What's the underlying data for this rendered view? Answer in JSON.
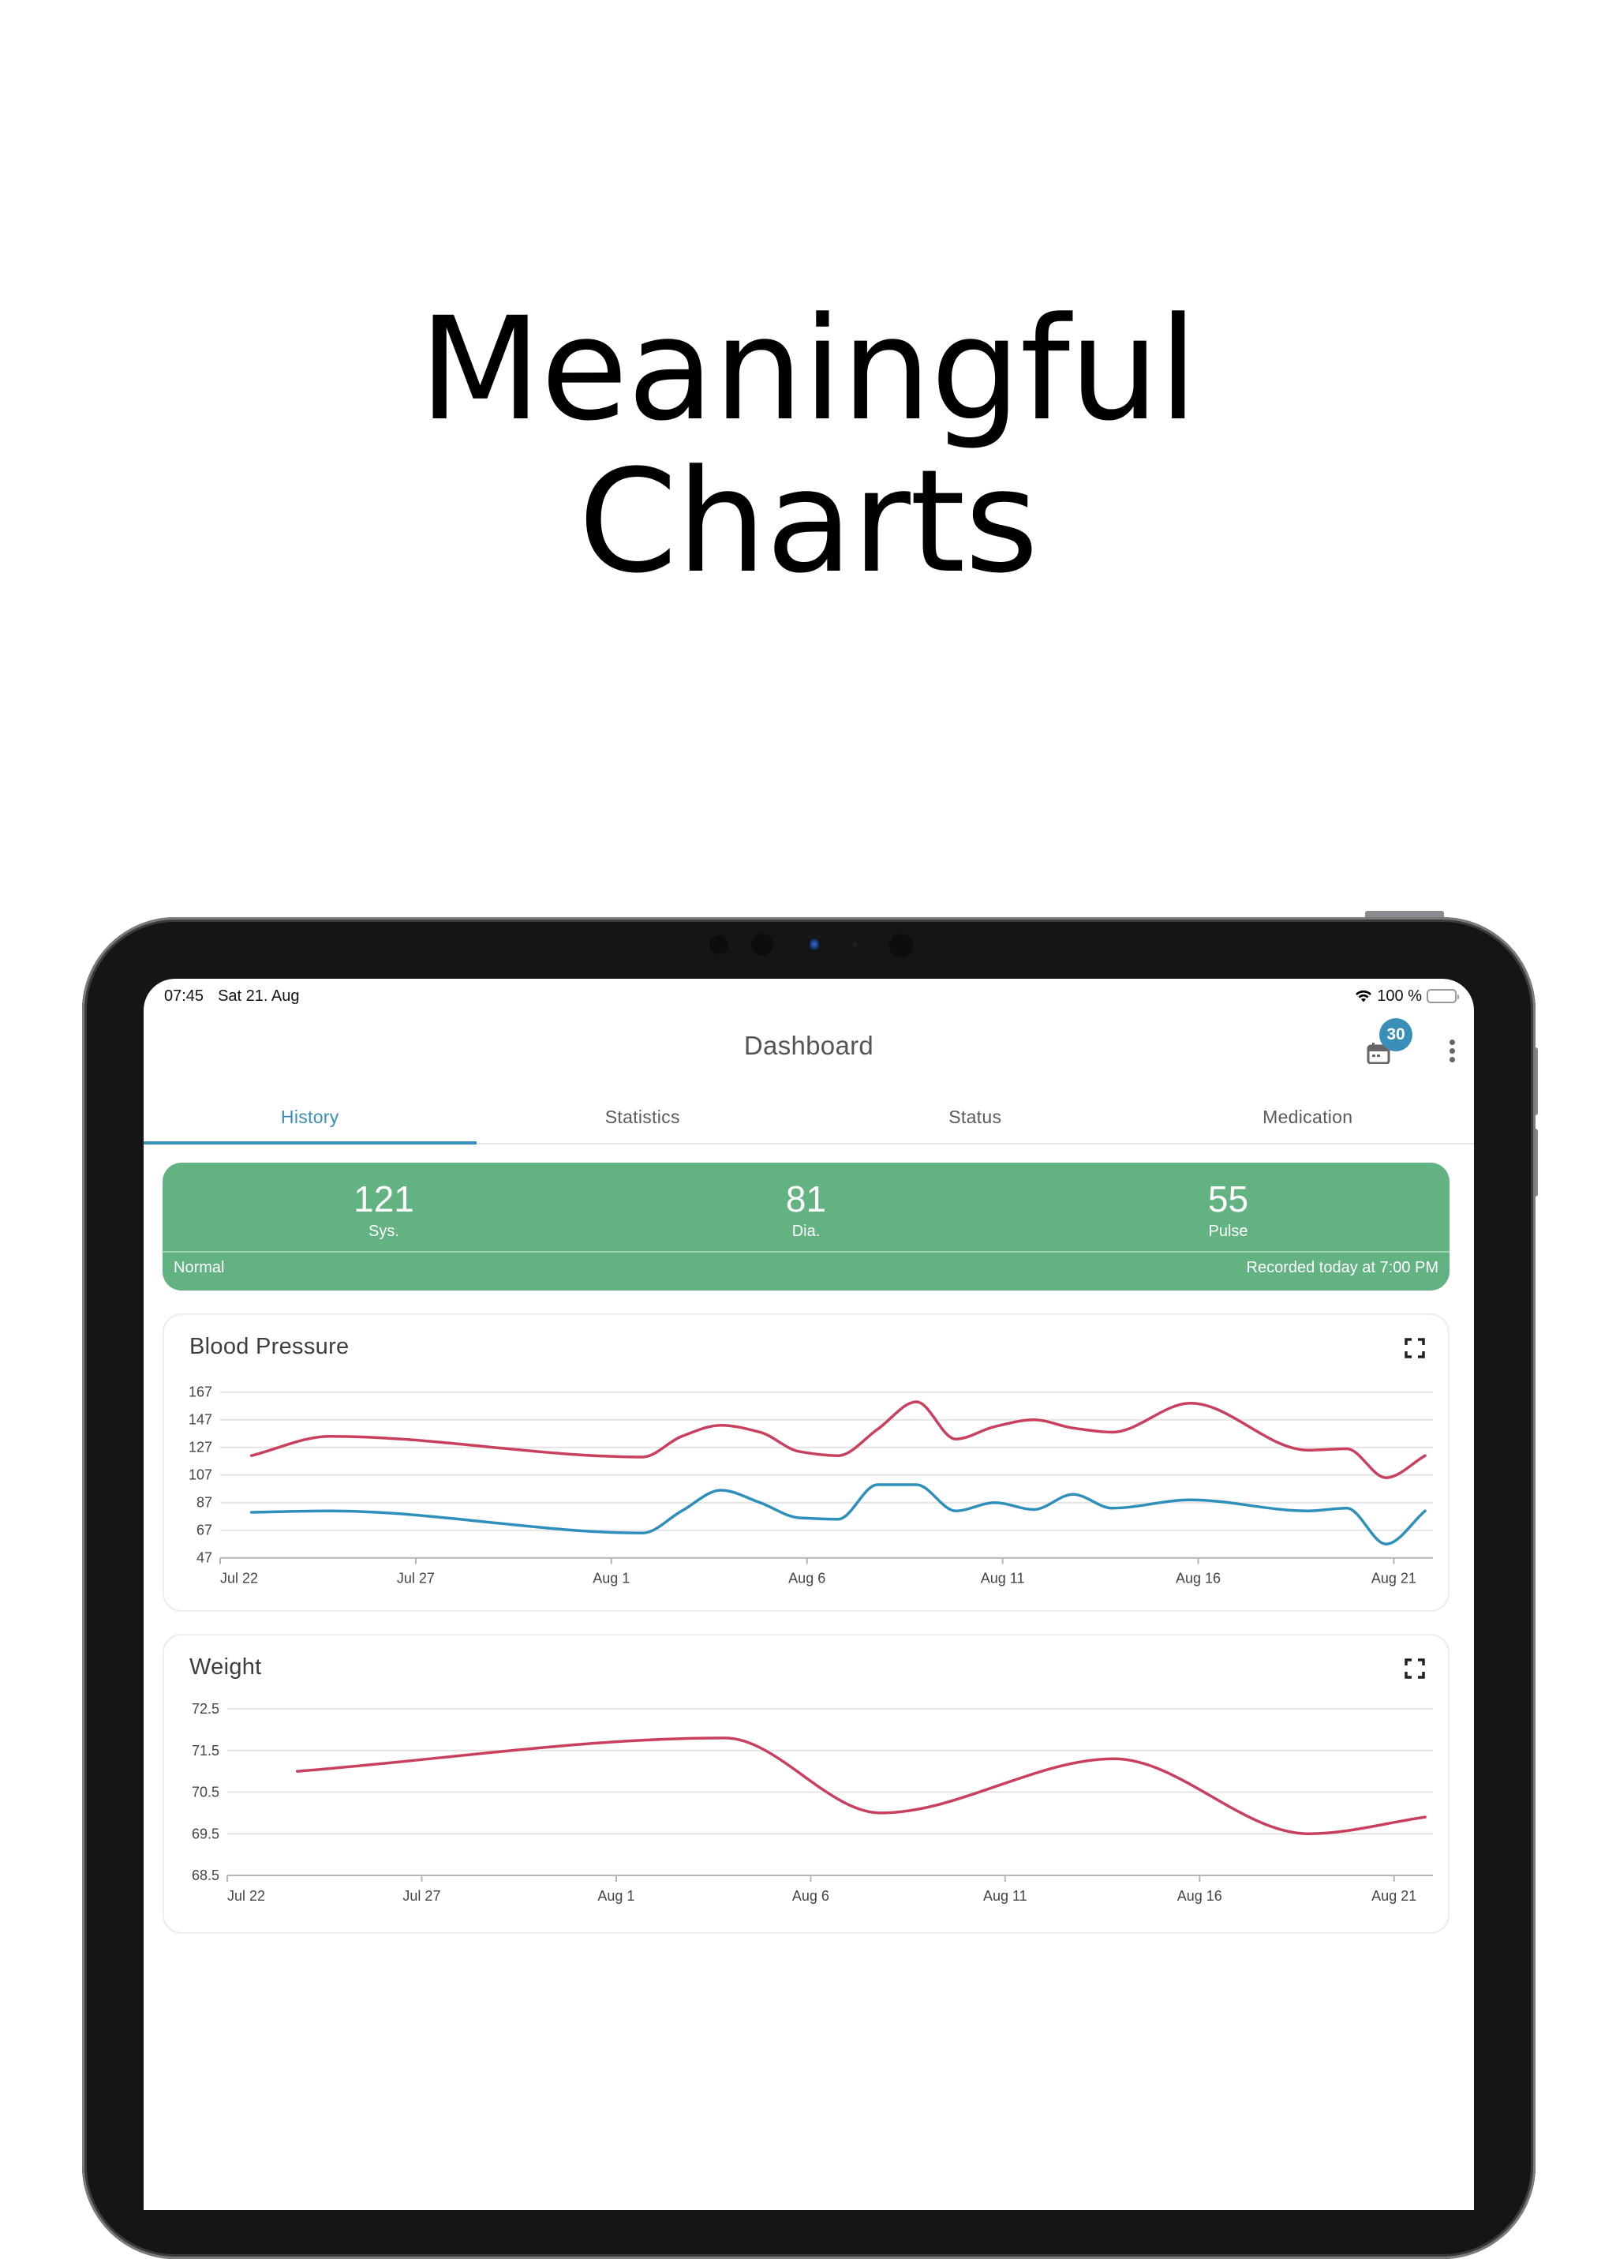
{
  "headline": {
    "line1": "Meaningful",
    "line2": "Charts"
  },
  "status_bar": {
    "time": "07:45",
    "date": "Sat 21. Aug",
    "battery": "100 %",
    "battery_level": 1.0
  },
  "app_bar": {
    "title": "Dashboard",
    "calendar_badge": "30"
  },
  "tabs": [
    {
      "label": "History",
      "active": true
    },
    {
      "label": "Statistics",
      "active": false
    },
    {
      "label": "Status",
      "active": false
    },
    {
      "label": "Medication",
      "active": false
    }
  ],
  "summary": {
    "systolic": {
      "value": "121",
      "label": "Sys."
    },
    "diastolic": {
      "value": "81",
      "label": "Dia."
    },
    "pulse": {
      "value": "55",
      "label": "Pulse"
    },
    "category": "Normal",
    "recorded": "Recorded today at 7:00 PM"
  },
  "colors": {
    "accent": "#3a8fb9",
    "normal_green": "#63b382",
    "systolic_line": "#c8405e",
    "diastolic_line": "#2f8fbb",
    "weight_line": "#c8405e"
  },
  "chart_data": [
    {
      "type": "line",
      "title": "Blood Pressure",
      "xlabel": "",
      "ylabel": "",
      "x_ticks": [
        "Jul 22",
        "Jul 27",
        "Aug 1",
        "Aug 6",
        "Aug 11",
        "Aug 16",
        "Aug 21"
      ],
      "x_start": "Jul 22",
      "x_unit": "days since Jul 22",
      "xlim": [
        0,
        31
      ],
      "y_ticks": [
        47,
        67,
        87,
        107,
        127,
        147,
        167
      ],
      "ylim": [
        47,
        167
      ],
      "grid": true,
      "x": [
        0.8,
        2.8,
        10.8,
        11.8,
        12.8,
        13.8,
        14.8,
        15.8,
        16.8,
        17.8,
        18.8,
        19.8,
        20.8,
        21.8,
        22.8,
        24.8,
        27.8,
        28.8,
        29.8,
        30.8
      ],
      "series": [
        {
          "name": "Systolic",
          "color": "#c8405e",
          "values": [
            121,
            135,
            120,
            135,
            143,
            138,
            124,
            121,
            140,
            160,
            133,
            142,
            147,
            141,
            138,
            159,
            125,
            126,
            105,
            121
          ]
        },
        {
          "name": "Diastolic",
          "color": "#2f8fbb",
          "values": [
            80,
            81,
            65,
            81,
            96,
            87,
            76,
            75,
            100,
            100,
            81,
            87,
            82,
            93,
            83,
            89,
            81,
            83,
            57,
            81
          ]
        }
      ]
    },
    {
      "type": "line",
      "title": "Weight",
      "xlabel": "",
      "ylabel": "",
      "x_ticks": [
        "Jul 22",
        "Jul 27",
        "Aug 1",
        "Aug 6",
        "Aug 11",
        "Aug 16",
        "Aug 21"
      ],
      "x_start": "Jul 22",
      "x_unit": "days since Jul 22",
      "xlim": [
        0,
        31
      ],
      "y_ticks": [
        "68.5",
        "69.5",
        "70.5",
        "71.5",
        "72.5"
      ],
      "ylim": [
        68.5,
        72.5
      ],
      "grid": true,
      "x": [
        1.8,
        12.8,
        16.8,
        22.8,
        27.8,
        30.8
      ],
      "series": [
        {
          "name": "Weight",
          "color": "#c8405e",
          "values": [
            71.0,
            71.8,
            70.0,
            71.3,
            69.5,
            69.9
          ]
        }
      ]
    }
  ]
}
